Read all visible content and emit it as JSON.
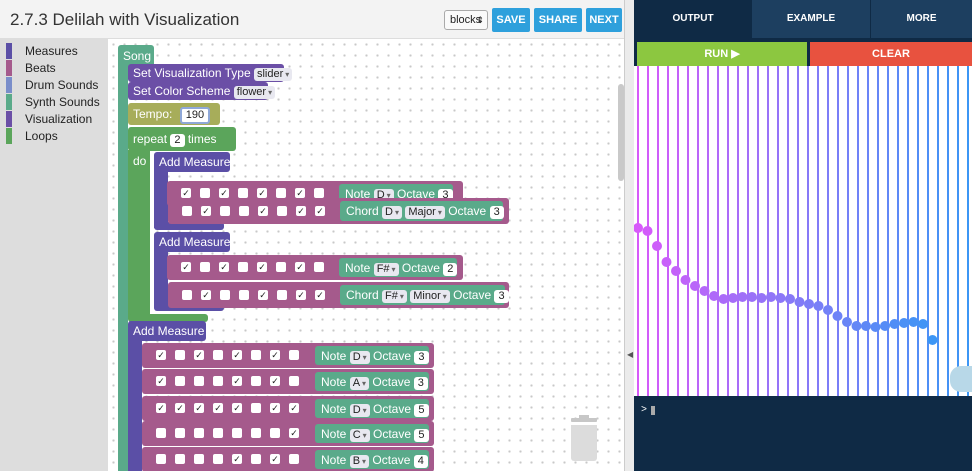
{
  "header": {
    "title": "2.7.3 Delilah with Visualization",
    "mode_select": "blocks",
    "save_label": "SAVE",
    "share_label": "SHARE",
    "next_label": "NEXT"
  },
  "toolbox": [
    {
      "label": "Measures",
      "color": "#5b4fa6"
    },
    {
      "label": "Beats",
      "color": "#a55a8c"
    },
    {
      "label": "Drum Sounds",
      "color": "#7a8eca"
    },
    {
      "label": "Synth Sounds",
      "color": "#5aaa8a"
    },
    {
      "label": "Visualization",
      "color": "#6b4fa6"
    },
    {
      "label": "Loops",
      "color": "#5ba55b"
    }
  ],
  "blocks": {
    "song": "Song",
    "set_viz": "Set Visualization Type",
    "viz_value": "slider",
    "set_color": "Set Color Scheme",
    "color_value": "flower",
    "tempo_label": "Tempo:",
    "tempo_value": "190",
    "repeat": "repeat",
    "repeat_count": "2",
    "times": "times",
    "do": "do",
    "add_measure": "Add Measure",
    "note": "Note",
    "chord": "Chord",
    "octave": "Octave",
    "rows": [
      {
        "checks": [
          1,
          0,
          1,
          0,
          1,
          0,
          1,
          0
        ],
        "type": "note",
        "pitch": "D",
        "octave": "3"
      },
      {
        "checks": [
          0,
          1,
          0,
          0,
          1,
          0,
          1,
          1
        ],
        "type": "chord",
        "pitch": "D",
        "quality": "Major",
        "octave": "3"
      },
      {
        "checks": [
          1,
          0,
          1,
          0,
          1,
          0,
          1,
          0
        ],
        "type": "note",
        "pitch": "F#",
        "octave": "2"
      },
      {
        "checks": [
          0,
          1,
          0,
          0,
          1,
          0,
          1,
          1
        ],
        "type": "chord",
        "pitch": "F#",
        "quality": "Minor",
        "octave": "3"
      },
      {
        "checks": [
          1,
          0,
          1,
          0,
          1,
          0,
          1,
          0
        ],
        "type": "note",
        "pitch": "D",
        "octave": "3"
      },
      {
        "checks": [
          1,
          0,
          0,
          0,
          1,
          0,
          1,
          0
        ],
        "type": "note",
        "pitch": "A",
        "octave": "3"
      },
      {
        "checks": [
          1,
          1,
          1,
          1,
          1,
          0,
          1,
          1
        ],
        "type": "note",
        "pitch": "D",
        "octave": "5"
      },
      {
        "checks": [
          0,
          0,
          0,
          0,
          0,
          0,
          0,
          1
        ],
        "type": "note",
        "pitch": "C",
        "octave": "5"
      },
      {
        "checks": [
          0,
          0,
          0,
          0,
          1,
          0,
          1,
          0
        ],
        "type": "note",
        "pitch": "B",
        "octave": "4"
      }
    ]
  },
  "right_tabs": {
    "output": "OUTPUT",
    "example": "EXAMPLE",
    "more": "MORE"
  },
  "run_label": "RUN ▶",
  "clear_label": "CLEAR",
  "console_prompt": ">",
  "colors": {
    "accent": "#2ea0dc",
    "run": "#8cc740",
    "clear": "#e8523f",
    "panel": "#0f2a45",
    "measure": "#5b4fa6",
    "beat_row": "#a55a8c",
    "note": "#5aaa8a",
    "loop": "#5ba55b",
    "tempo": "#a7ad5a"
  }
}
